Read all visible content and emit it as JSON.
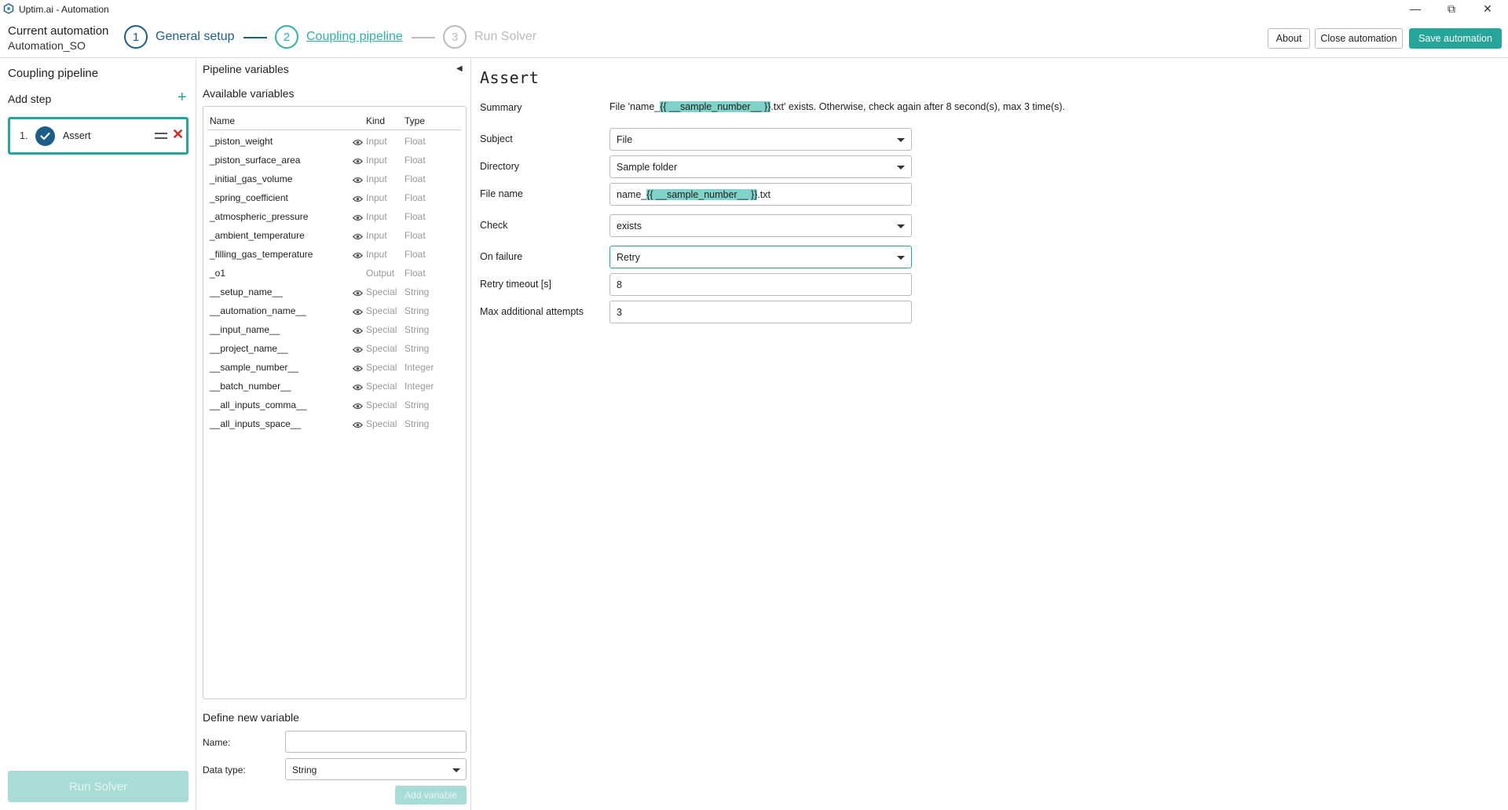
{
  "window": {
    "title": "Uptim.ai - Automation",
    "controls": {
      "minimize": "—",
      "maximize": "⧉",
      "close": "✕"
    }
  },
  "header": {
    "current_label": "Current automation",
    "current_name": "Automation_SO",
    "steps": [
      {
        "num": "1",
        "label": "General setup"
      },
      {
        "num": "2",
        "label": "Coupling pipeline"
      },
      {
        "num": "3",
        "label": "Run Solver"
      }
    ],
    "about": "About",
    "close_automation": "Close automation",
    "save_automation": "Save automation"
  },
  "left": {
    "title": "Coupling pipeline",
    "add_step": "Add step",
    "add_icon": "+",
    "step_card": {
      "index": "1.",
      "label": "Assert",
      "delete_icon": "✕"
    },
    "run_solver": "Run Solver"
  },
  "middle": {
    "title": "Pipeline variables",
    "collapse_icon": "◀",
    "available": "Available variables",
    "columns": {
      "name": "Name",
      "kind": "Kind",
      "type": "Type"
    },
    "variables": [
      {
        "name": "_piston_weight",
        "kind": "Input",
        "type": "Float",
        "eye": true
      },
      {
        "name": "_piston_surface_area",
        "kind": "Input",
        "type": "Float",
        "eye": true
      },
      {
        "name": "_initial_gas_volume",
        "kind": "Input",
        "type": "Float",
        "eye": true
      },
      {
        "name": "_spring_coefficient",
        "kind": "Input",
        "type": "Float",
        "eye": true
      },
      {
        "name": "_atmospheric_pressure",
        "kind": "Input",
        "type": "Float",
        "eye": true
      },
      {
        "name": "_ambient_temperature",
        "kind": "Input",
        "type": "Float",
        "eye": true
      },
      {
        "name": "_filling_gas_temperature",
        "kind": "Input",
        "type": "Float",
        "eye": true
      },
      {
        "name": "_o1",
        "kind": "Output",
        "type": "Float",
        "eye": false
      },
      {
        "name": "__setup_name__",
        "kind": "Special",
        "type": "String",
        "eye": true
      },
      {
        "name": "__automation_name__",
        "kind": "Special",
        "type": "String",
        "eye": true
      },
      {
        "name": "__input_name__",
        "kind": "Special",
        "type": "String",
        "eye": true
      },
      {
        "name": "__project_name__",
        "kind": "Special",
        "type": "String",
        "eye": true
      },
      {
        "name": "__sample_number__",
        "kind": "Special",
        "type": "Integer",
        "eye": true
      },
      {
        "name": "__batch_number__",
        "kind": "Special",
        "type": "Integer",
        "eye": true
      },
      {
        "name": "__all_inputs_comma__",
        "kind": "Special",
        "type": "String",
        "eye": true
      },
      {
        "name": "__all_inputs_space__",
        "kind": "Special",
        "type": "String",
        "eye": true
      }
    ],
    "define_new": "Define new variable",
    "name_label": "Name:",
    "name_value": "",
    "data_type_label": "Data type:",
    "data_type_value": "String",
    "add_variable": "Add variable"
  },
  "right": {
    "title": "Assert",
    "summary_label": "Summary",
    "summary": {
      "prefix": "File 'name_",
      "highlight": "{{ __sample_number__ }}",
      "suffix": ".txt' exists. Otherwise, check again after 8 second(s), max 3 time(s)."
    },
    "subject_label": "Subject",
    "subject_value": "File",
    "directory_label": "Directory",
    "directory_value": "Sample folder",
    "filename_label": "File name",
    "filename": {
      "prefix": "name_",
      "highlight": "{{ __sample_number__ }}",
      "suffix": ".txt"
    },
    "check_label": "Check",
    "check_value": "exists",
    "onfailure_label": "On failure",
    "onfailure_value": "Retry",
    "retry_timeout_label": "Retry timeout [s]",
    "retry_timeout_value": "8",
    "max_attempts_label": "Max additional attempts",
    "max_attempts_value": "3"
  },
  "colors": {
    "accent": "#26a69a",
    "primary": "#1b5e8a",
    "highlight": "#7fd3c9",
    "delete": "#e02424",
    "disabled_button": "#a8ddd7"
  }
}
